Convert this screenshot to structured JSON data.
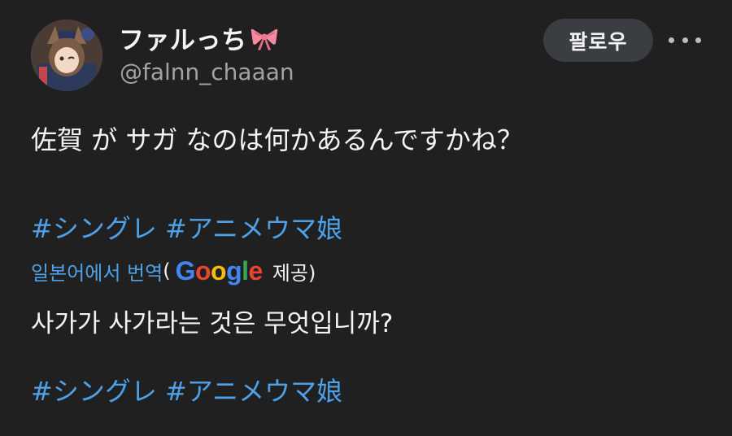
{
  "user": {
    "display_name": "ファルっち",
    "handle": "@falnn_chaaan",
    "avatar_icon": "avatar-image"
  },
  "header": {
    "follow_label": "팔로우",
    "more_icon": "more-horizontal-icon"
  },
  "tweet": {
    "text": "佐賀 が サガ なのは何かあるんですかね？",
    "hashtags": "#シングレ #アニメウマ娘"
  },
  "translation": {
    "link_label": "일본어에서 번역",
    "open_paren": "(",
    "google_logo": "Google",
    "provider_suffix": "제공)",
    "translated_text": "사가가 사가라는 것은 무엇입니까?",
    "hashtags": "#シングレ #アニメウマ娘"
  },
  "colors": {
    "background": "#202020",
    "link": "#4ea1e8",
    "follow_button_bg": "#3a3d42",
    "secondary_text": "#a3a3a3"
  }
}
